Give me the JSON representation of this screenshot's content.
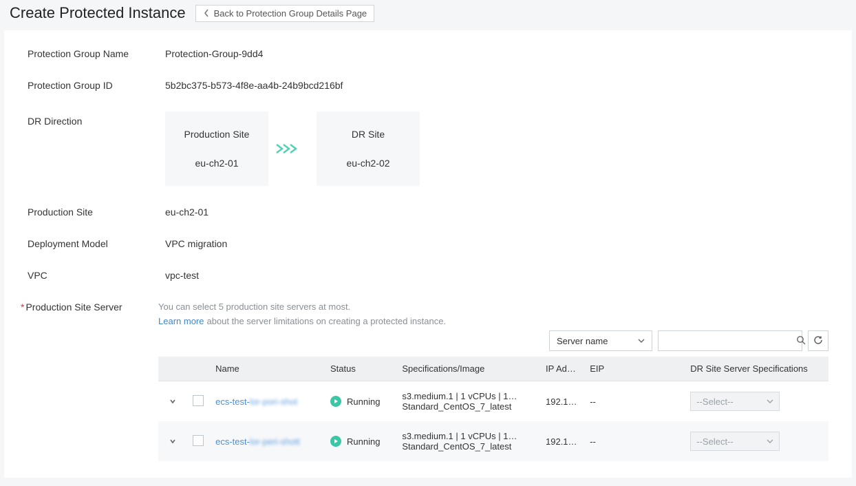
{
  "header": {
    "title": "Create Protected Instance",
    "back_button": "Back to Protection Group Details Page"
  },
  "fields": {
    "protection_group_name": {
      "label": "Protection Group Name",
      "value": "Protection-Group-9dd4"
    },
    "protection_group_id": {
      "label": "Protection Group ID",
      "value": "5b2bc375-b573-4f8e-aa4b-24b9bcd216bf"
    },
    "dr_direction": {
      "label": "DR Direction"
    },
    "production_site": {
      "label": "Production Site",
      "value": "eu-ch2-01"
    },
    "deployment_model": {
      "label": "Deployment Model",
      "value": "VPC migration"
    },
    "vpc": {
      "label": "VPC",
      "value": "vpc-test"
    },
    "production_site_server": {
      "label": "Production Site Server"
    }
  },
  "dr_direction": {
    "production_site": {
      "title": "Production Site",
      "value": "eu-ch2-01"
    },
    "dr_site": {
      "title": "DR Site",
      "value": "eu-ch2-02"
    }
  },
  "server_section": {
    "hint_line1": "You can select 5 production site servers at most.",
    "hint_link": "Learn more",
    "hint_line2_rest": "about the server limitations on creating a protected instance.",
    "filter_field_label": "Server name",
    "select_placeholder": "--Select--"
  },
  "table": {
    "columns": {
      "name": "Name",
      "status": "Status",
      "spec": "Specifications/Image",
      "ip": "IP Ad…",
      "eip": "EIP",
      "drspec": "DR Site Server Specifications"
    },
    "rows": [
      {
        "name_prefix": "ecs-test-",
        "name_blur": "lor-pori-shot",
        "status": "Running",
        "spec_line1": "s3.medium.1 | 1 vCPUs | 1…",
        "spec_line2": "Standard_CentOS_7_latest",
        "ip": "192.1…",
        "eip": "--"
      },
      {
        "name_prefix": "ecs-test-",
        "name_blur": "lor-peri-shott",
        "status": "Running",
        "spec_line1": "s3.medium.1 | 1 vCPUs | 1…",
        "spec_line2": "Standard_CentOS_7_latest",
        "ip": "192.1…",
        "eip": "--"
      }
    ]
  }
}
